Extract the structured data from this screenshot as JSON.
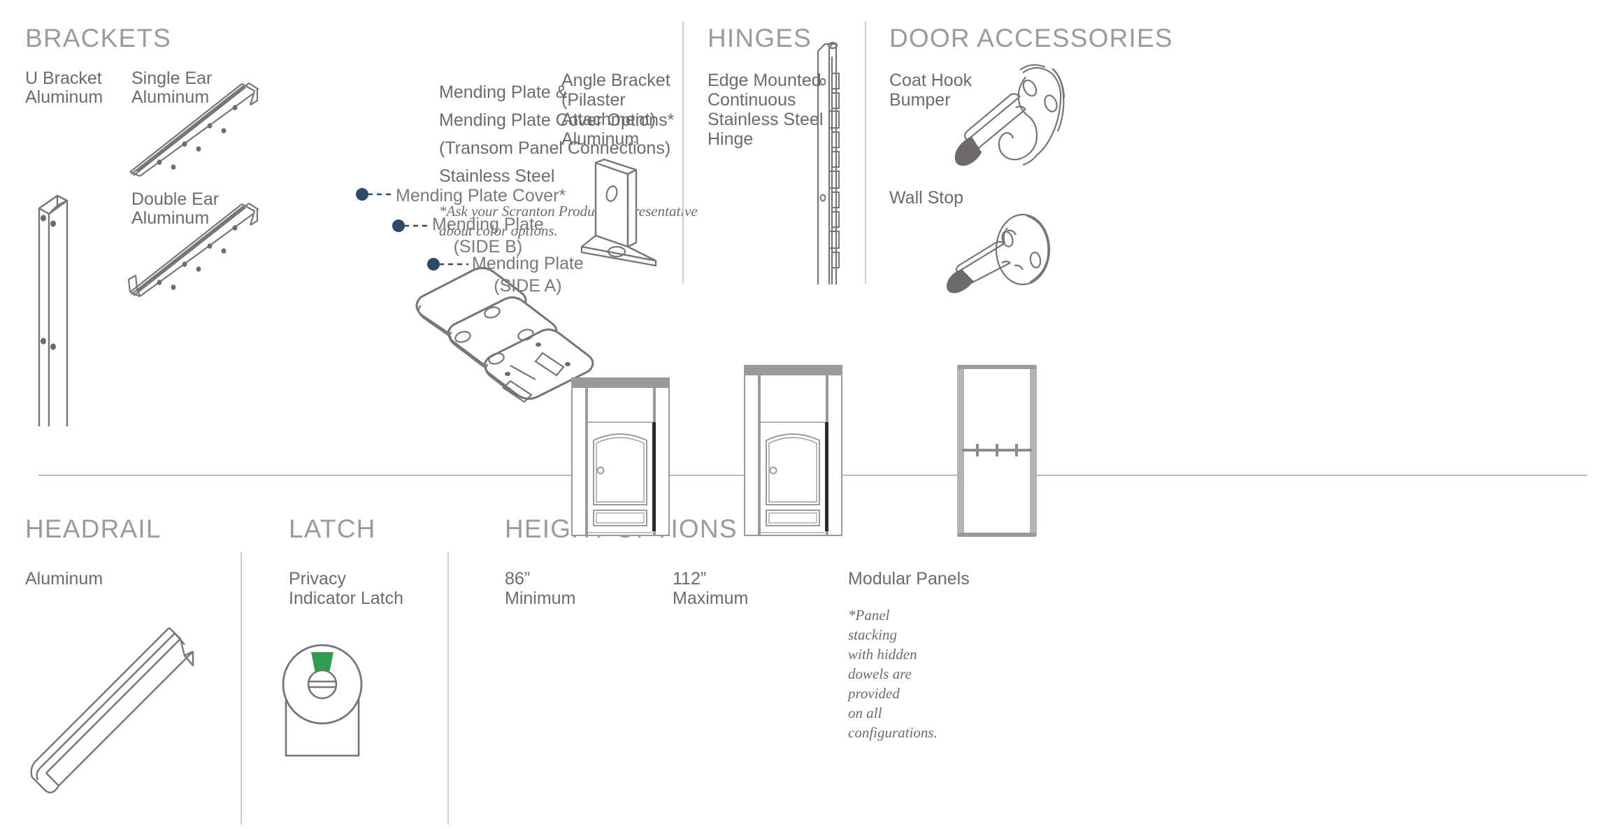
{
  "colors": {
    "heading": "#9b9b9f",
    "body": "#6e6a6a",
    "line": "#7a7474",
    "divider": "#cfcfd2",
    "callout_dot": "#2e4a6b",
    "panel_gray": "#9a9a9e",
    "latch_green": "#2f9e4f",
    "bumper_gray": "#6e6a6a"
  },
  "sections": {
    "brackets": {
      "title": "BRACKETS",
      "items": {
        "u_bracket": {
          "name": "U Bracket",
          "material": "Aluminum"
        },
        "single_ear": {
          "name": "Single Ear",
          "material": "Aluminum"
        },
        "double_ear": {
          "name": "Double Ear",
          "material": "Aluminum"
        },
        "mending_plate": {
          "line1": "Mending Plate &",
          "line2": "Mending Plate Cover Options*",
          "line3": "(Transom Panel Connections)",
          "line4": "Stainless Steel",
          "note": "*Ask your Scranton Products representative\nabout color options.",
          "callouts": [
            "Mending Plate Cover*",
            "Mending Plate\n(SIDE B)",
            "Mending Plate\n(SIDE A)"
          ]
        },
        "angle_bracket": {
          "line1": "Angle Bracket",
          "line2": "(Pilaster",
          "line3": "Attachment)",
          "line4": "Aluminum"
        }
      }
    },
    "hinges": {
      "title": "HINGES",
      "item": {
        "line1": "Edge Mounted",
        "line2": "Continuous",
        "line3": "Stainless Steel",
        "line4": "Hinge"
      }
    },
    "door_accessories": {
      "title": "DOOR ACCESSORIES",
      "coat_hook": {
        "line1": "Coat Hook",
        "line2": "Bumper"
      },
      "wall_stop": {
        "line1": "Wall Stop"
      }
    },
    "headrail": {
      "title": "HEADRAIL",
      "material": "Aluminum"
    },
    "latch": {
      "title": "LATCH",
      "line1": "Privacy",
      "line2": "Indicator Latch"
    },
    "height_options": {
      "title": "HEIGHT OPTIONS",
      "minimum": {
        "value": "86”",
        "label": "Minimum"
      },
      "maximum": {
        "value": "112”",
        "label": "Maximum"
      },
      "modular": {
        "title": "Modular Panels",
        "note": "*Panel\nstacking\nwith hidden\ndowels are\nprovided\non all\nconfigurations."
      }
    }
  }
}
